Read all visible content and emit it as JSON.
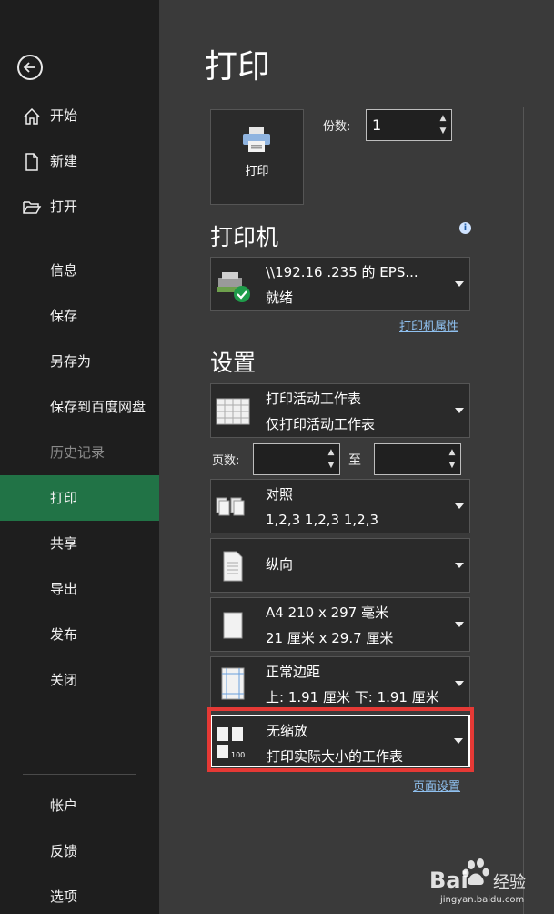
{
  "sidebar": {
    "items": [
      {
        "name": "nav-home",
        "icon": "home-icon",
        "label": "开始"
      },
      {
        "name": "nav-new",
        "icon": "new-file-icon",
        "label": "新建"
      },
      {
        "name": "nav-open",
        "icon": "folder-open-icon",
        "label": "打开"
      },
      {
        "name": "nav-info",
        "label": "信息"
      },
      {
        "name": "nav-save",
        "label": "保存"
      },
      {
        "name": "nav-save-as",
        "label": "另存为"
      },
      {
        "name": "nav-save-baidu",
        "label": "保存到百度网盘"
      },
      {
        "name": "nav-history",
        "label": "历史记录",
        "disabled": true
      },
      {
        "name": "nav-print",
        "label": "打印",
        "active": true
      },
      {
        "name": "nav-share",
        "label": "共享"
      },
      {
        "name": "nav-export",
        "label": "导出"
      },
      {
        "name": "nav-publish",
        "label": "发布"
      },
      {
        "name": "nav-close",
        "label": "关闭"
      },
      {
        "name": "nav-account",
        "label": "帐户"
      },
      {
        "name": "nav-feedback",
        "label": "反馈"
      },
      {
        "name": "nav-options",
        "label": "选项"
      }
    ]
  },
  "main": {
    "title": "打印",
    "print_button": "打印",
    "copies_label": "份数:",
    "copies_value": "1",
    "printer_heading": "打印机",
    "printer": {
      "name": "\\\\192.16   .235   的 EPS...",
      "status": "就绪"
    },
    "printer_properties": "打印机属性",
    "settings_heading": "设置",
    "settings": [
      {
        "name": "print-what-dropdown",
        "line1": "打印活动工作表",
        "line2": "仅打印活动工作表"
      },
      {
        "name": "collate-dropdown",
        "line1": "对照",
        "line2": "1,2,3    1,2,3    1,2,3"
      },
      {
        "name": "orientation-dropdown",
        "line1": "纵向",
        "line2": ""
      },
      {
        "name": "paper-size-dropdown",
        "line1": "A4 210 x 297 毫米",
        "line2": "21 厘米 x 29.7 厘米"
      },
      {
        "name": "margins-dropdown",
        "line1": "正常边距",
        "line2": "上: 1.91 厘米 下: 1.91 厘米"
      },
      {
        "name": "scaling-dropdown",
        "line1": "无缩放",
        "line2": "打印实际大小的工作表"
      }
    ],
    "pages_label": "页数:",
    "to_label": "至",
    "page_setup": "页面设置"
  },
  "watermark": {
    "brand": "Bai",
    "suffix": "经验",
    "url": "jingyan.baidu.com"
  },
  "colors": {
    "active_nav": "#217346",
    "link": "#8fc0ef",
    "highlight_box": "#e53935"
  }
}
